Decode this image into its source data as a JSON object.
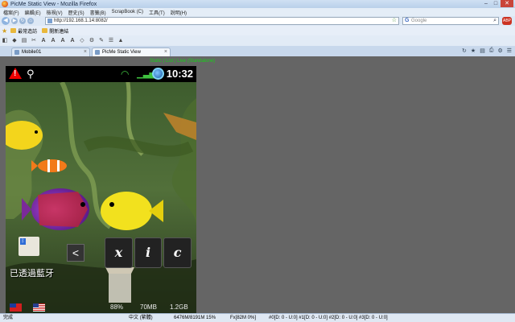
{
  "window": {
    "title": "PicMe Static View - Mozilla Firefox",
    "controls": [
      "–",
      "□",
      "✕"
    ]
  },
  "menu": [
    "檔案(F)",
    "編輯(E)",
    "檢視(V)",
    "歷史(S)",
    "書籤(B)",
    "ScrapBook (C)",
    "工具(T)",
    "說明(H)"
  ],
  "nav": {
    "url": "http://192.168.1.14:8082/",
    "search_placeholder": "Google",
    "search_engine_glyph": "G",
    "abp": "ABP"
  },
  "bookmarks": {
    "items": [
      "最常造訪",
      "開新連結"
    ]
  },
  "ext_toolbar_glyphs": [
    "A",
    "A",
    "A",
    "A"
  ],
  "tabs": [
    {
      "label": "Mobile01",
      "active": false
    },
    {
      "label": "PicMe Static View",
      "active": true
    }
  ],
  "content": {
    "status_links": "Static | List | Live (Standalone)",
    "phone": {
      "clock": "10:32",
      "controls": [
        "x",
        "i",
        "c"
      ],
      "toast": "已透過藍牙",
      "stats": [
        "88%",
        "70MB",
        "1.2GB"
      ]
    }
  },
  "statusbar": {
    "left": "完成",
    "ime": "中文 (繁體)",
    "memory": "6476M/8191M 15%",
    "fx": "Fx[82M 0%]",
    "threads": "#0[D: 0 - U:0] #1[D: 0 - U:0] #2[D: 0 - U:0] #3[D: 0 - U:0]"
  },
  "colors": {
    "content_bg": "#656565",
    "status_link": "#18d018",
    "chrome": "#dde8f5"
  }
}
